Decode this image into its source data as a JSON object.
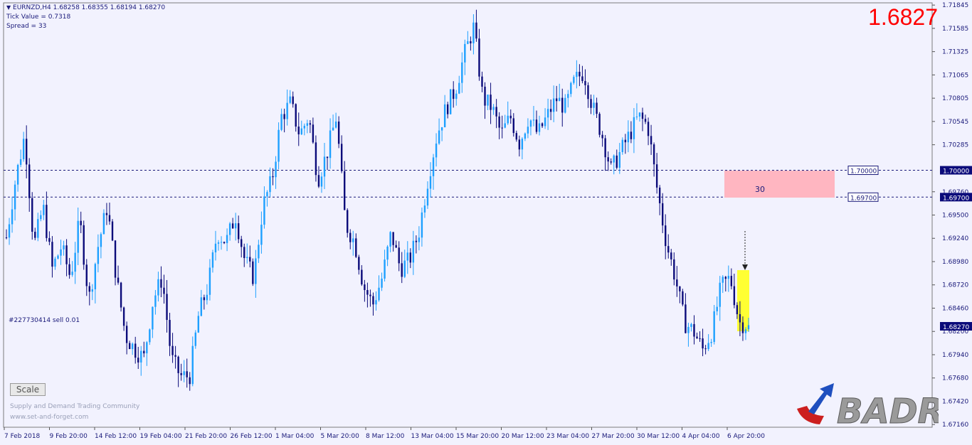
{
  "header": {
    "symbol_line": "EURNZD,H4  1.68258 1.68355 1.68194 1.68270",
    "tick_value": "Tick Value = 0.7318",
    "spread": "Spread = 33"
  },
  "big_price": "1.6827",
  "order_label": "#227730414 sell 0.01",
  "scale_button": "Scale",
  "footer": {
    "community": "Supply and Demand Trading Community",
    "url": "www.set-and-forget.com"
  },
  "logo_text": "BADR",
  "zone_label": "30",
  "colors": {
    "bull": "#1ea0ff",
    "bear": "#0b0b7a",
    "zone": "#ffb6c1",
    "highlight": "#ffff33",
    "price_marker": "#0b0b7a"
  },
  "chart_data": {
    "type": "candlestick",
    "timeframe": "H4",
    "symbol": "EURNZD",
    "ylim": [
      1.6713,
      1.7187
    ],
    "y_ticks": [
      "1.71845",
      "1.71585",
      "1.71325",
      "1.71065",
      "1.70805",
      "1.70545",
      "1.70285",
      "1.69760",
      "1.69500",
      "1.69240",
      "1.68980",
      "1.68720",
      "1.68460",
      "1.68200",
      "1.67940",
      "1.67680",
      "1.67420",
      "1.67160"
    ],
    "x_labels": [
      "7 Feb 2018",
      "9 Feb 20:00",
      "14 Feb 12:00",
      "19 Feb 04:00",
      "21 Feb 20:00",
      "26 Feb 12:00",
      "1 Mar 04:00",
      "5 Mar 20:00",
      "8 Mar 12:00",
      "13 Mar 04:00",
      "15 Mar 20:00",
      "20 Mar 12:00",
      "23 Mar 04:00",
      "27 Mar 20:00",
      "30 Mar 12:00",
      "4 Apr 04:00",
      "6 Apr 20:00"
    ],
    "levels": [
      {
        "price": 1.7,
        "label": "1.70000"
      },
      {
        "price": 1.697,
        "label": "1.69700"
      }
    ],
    "current_price": "1.68270",
    "path": [
      1.6925,
      1.699,
      1.704,
      1.6915,
      1.696,
      1.689,
      1.6915,
      1.688,
      1.6945,
      1.6855,
      1.6915,
      1.696,
      1.688,
      1.6815,
      1.68,
      1.679,
      1.6855,
      1.688,
      1.679,
      1.677,
      1.677,
      1.684,
      1.687,
      1.693,
      1.692,
      1.695,
      1.69,
      1.688,
      1.696,
      1.699,
      1.706,
      1.7075,
      1.704,
      1.706,
      1.699,
      1.702,
      1.706,
      1.694,
      1.692,
      1.687,
      1.685,
      1.688,
      1.693,
      1.689,
      1.69,
      1.693,
      1.699,
      1.704,
      1.707,
      1.709,
      1.713,
      1.716,
      1.708,
      1.707,
      1.704,
      1.706,
      1.703,
      1.706,
      1.704,
      1.706,
      1.708,
      1.707,
      1.71,
      1.711,
      1.707,
      1.704,
      1.7,
      1.702,
      1.704,
      1.706,
      1.705,
      1.698,
      1.692,
      1.688,
      1.683,
      1.682,
      1.68,
      1.682,
      1.687,
      1.688,
      1.683,
      1.6827
    ]
  }
}
